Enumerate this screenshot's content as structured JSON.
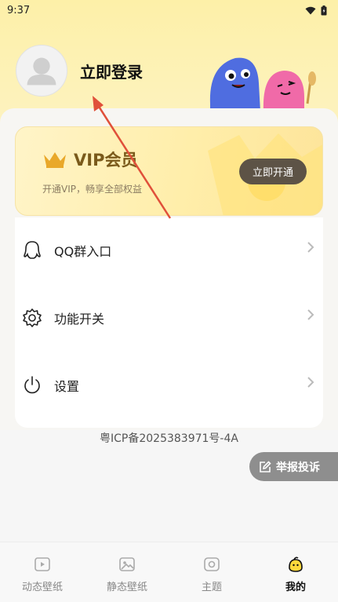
{
  "status_bar": {
    "time": "9:37",
    "wifi_icon": "wifi-icon",
    "battery_icon": "battery-icon"
  },
  "profile": {
    "login_label": "立即登录",
    "avatar_icon": "default-avatar-icon"
  },
  "vip": {
    "title": "VIP会员",
    "subtitle": "开通VIP，畅享全部权益",
    "button_label": "立即开通",
    "crown_icon": "crown-icon"
  },
  "menu": {
    "items": [
      {
        "label": "QQ群入口",
        "icon": "qq-icon"
      },
      {
        "label": "功能开关",
        "icon": "gear-icon"
      },
      {
        "label": "设置",
        "icon": "power-icon"
      }
    ]
  },
  "icp": "粤ICP备2025383971号-4A",
  "report": {
    "label": "举报投诉",
    "icon": "edit-icon"
  },
  "tabs": [
    {
      "label": "动态壁纸",
      "icon": "video-icon",
      "active": false
    },
    {
      "label": "静态壁纸",
      "icon": "image-icon",
      "active": false
    },
    {
      "label": "主题",
      "icon": "theme-icon",
      "active": false
    },
    {
      "label": "我的",
      "icon": "mine-icon",
      "active": true
    }
  ],
  "colors": {
    "accent_arrow": "#e0503a",
    "vip_button": "#5d5346",
    "vip_text": "#7a5a1b"
  }
}
